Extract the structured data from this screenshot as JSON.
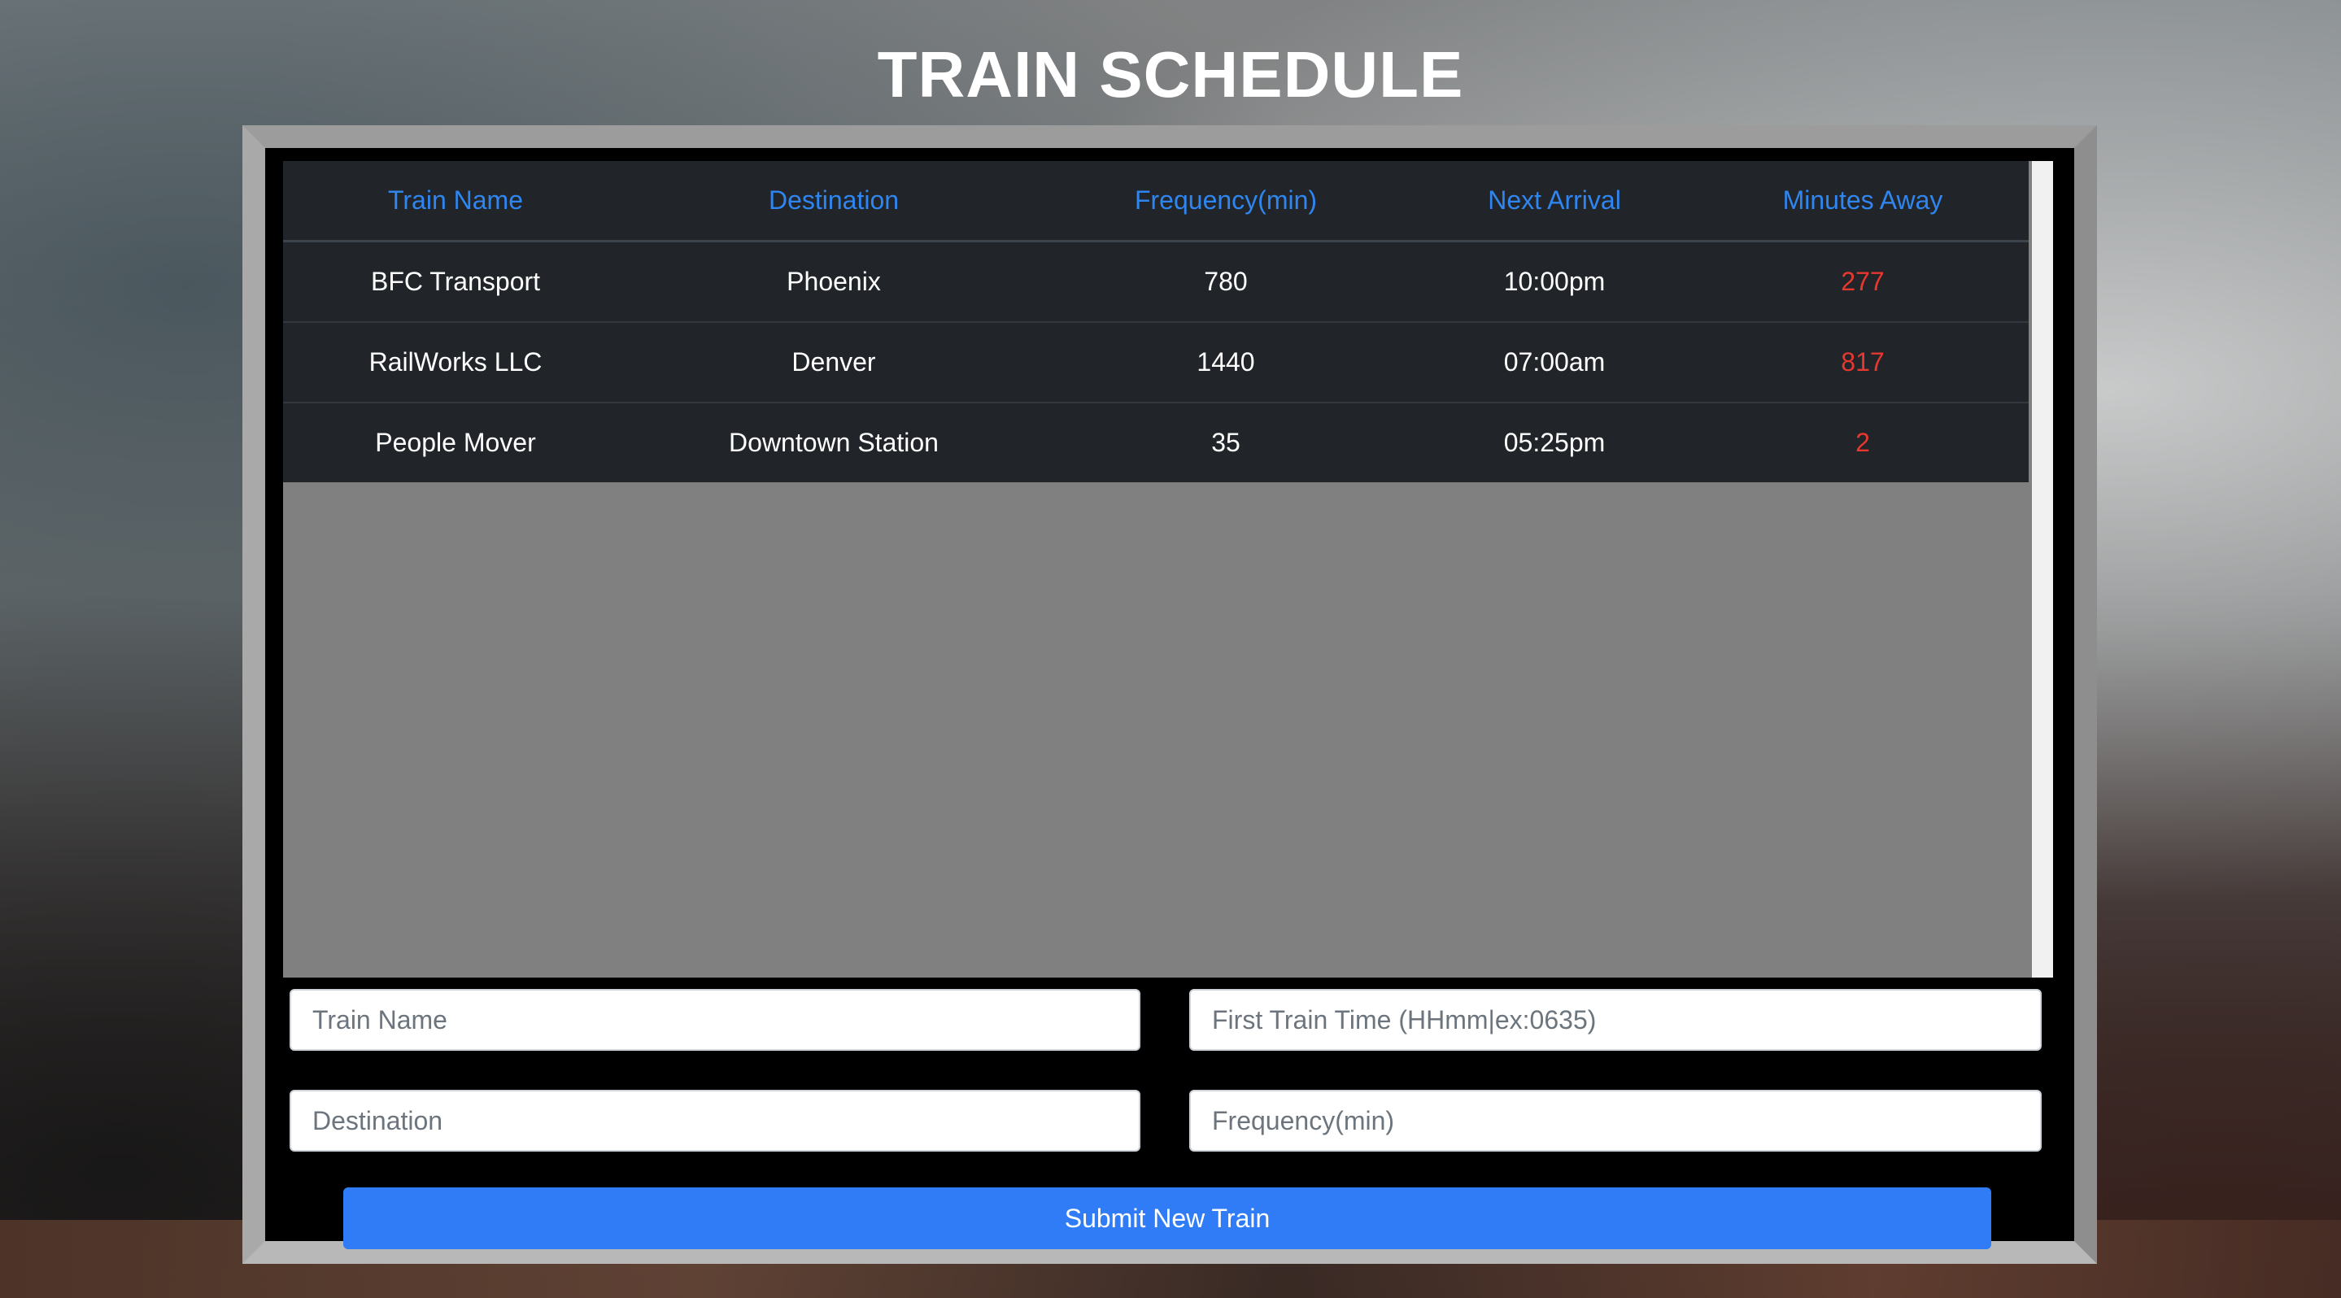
{
  "page": {
    "title": "TRAIN SCHEDULE"
  },
  "table": {
    "headers": [
      "Train Name",
      "Destination",
      "Frequency(min)",
      "Next Arrival",
      "Minutes Away"
    ],
    "rows": [
      {
        "name": "BFC Transport",
        "destination": "Phoenix",
        "frequency": "780",
        "next_arrival": "10:00pm",
        "minutes_away": "277"
      },
      {
        "name": "RailWorks LLC",
        "destination": "Denver",
        "frequency": "1440",
        "next_arrival": "07:00am",
        "minutes_away": "817"
      },
      {
        "name": "People Mover",
        "destination": "Downtown Station",
        "frequency": "35",
        "next_arrival": "05:25pm",
        "minutes_away": "2"
      }
    ]
  },
  "form": {
    "train_name_placeholder": "Train Name",
    "first_time_placeholder": "First Train Time (HHmm|ex:0635)",
    "destination_placeholder": "Destination",
    "frequency_placeholder": "Frequency(min)",
    "submit_label": "Submit New Train"
  },
  "colors": {
    "header_text": "#2f86f0",
    "minutes_away_text": "#e8372f",
    "table_background": "#212529",
    "submit_button": "#2f7cf6"
  }
}
